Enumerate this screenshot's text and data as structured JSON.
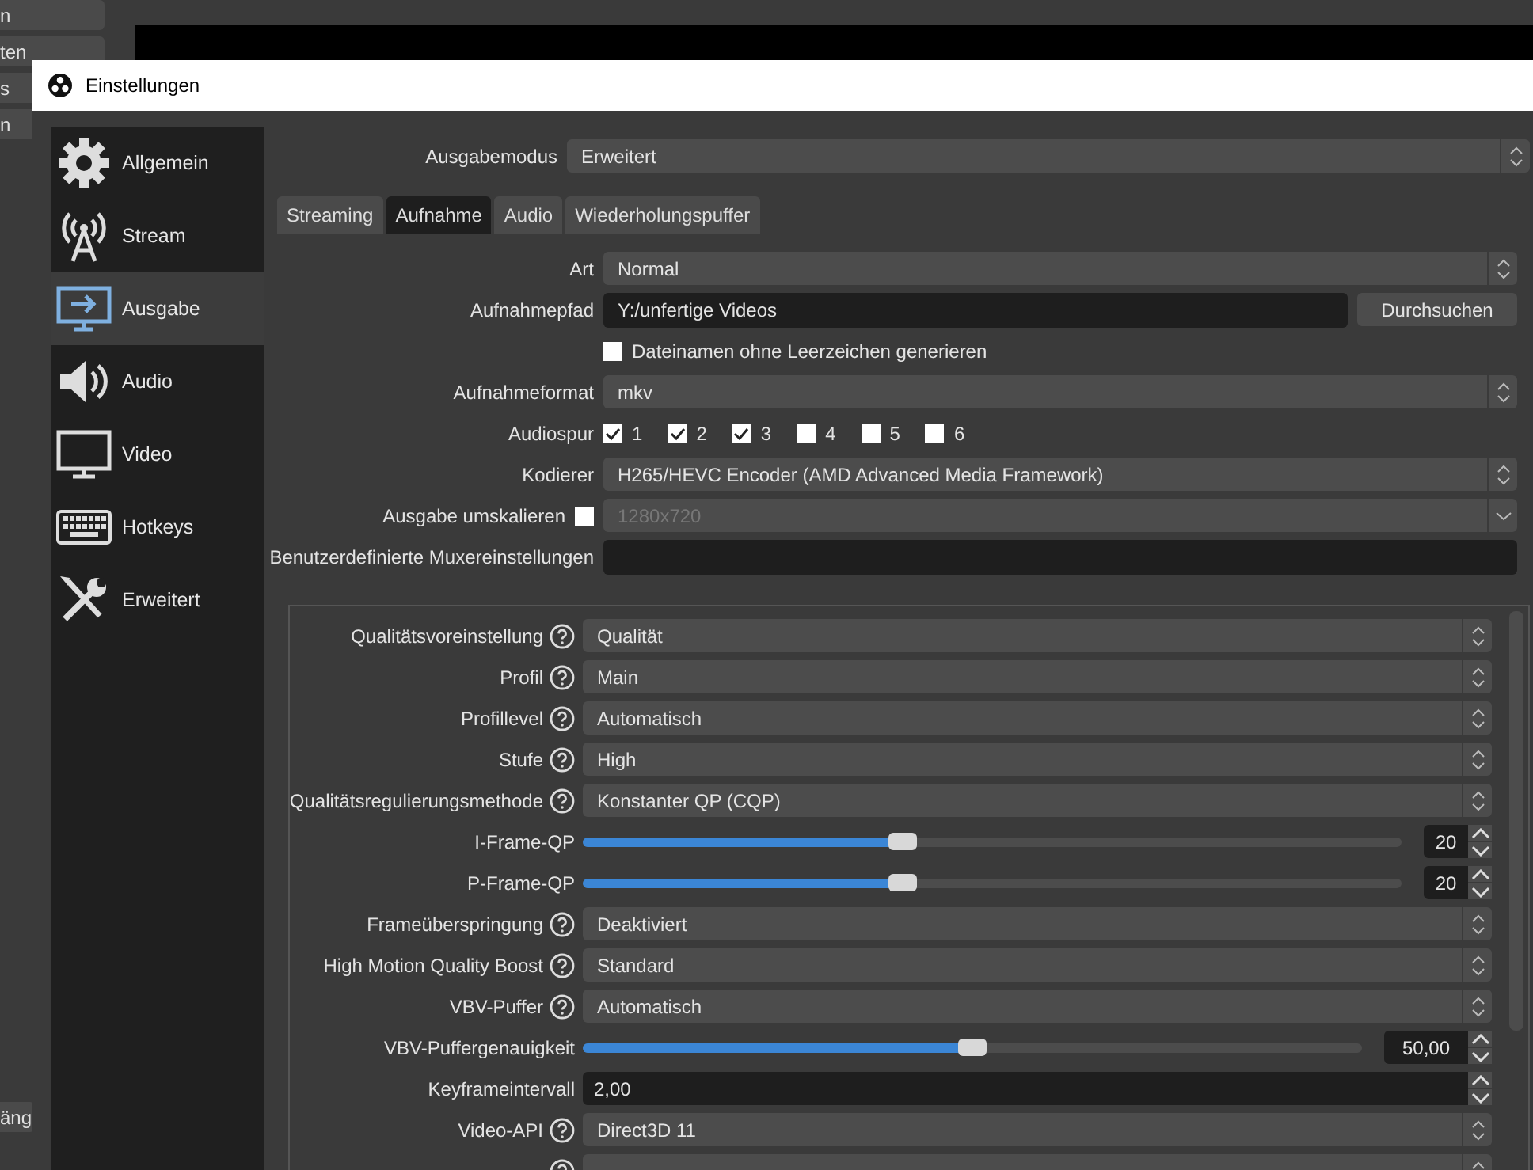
{
  "background_window": {
    "side_buttons": [
      "n",
      "ten",
      "s",
      "n"
    ],
    "bottom_button": "äng"
  },
  "window": {
    "title": "Einstellungen"
  },
  "sidebar": {
    "items": [
      {
        "label": "Allgemein",
        "kind": "gear",
        "selected": false
      },
      {
        "label": "Stream",
        "kind": "antenna",
        "selected": false
      },
      {
        "label": "Ausgabe",
        "kind": "output",
        "selected": true
      },
      {
        "label": "Audio",
        "kind": "speaker",
        "selected": false
      },
      {
        "label": "Video",
        "kind": "monitor",
        "selected": false
      },
      {
        "label": "Hotkeys",
        "kind": "keyboard",
        "selected": false
      },
      {
        "label": "Erweitert",
        "kind": "tools",
        "selected": false
      }
    ]
  },
  "output_mode": {
    "label": "Ausgabemodus",
    "value": "Erweitert"
  },
  "tabs": [
    {
      "label": "Streaming",
      "selected": false
    },
    {
      "label": "Aufnahme",
      "selected": true
    },
    {
      "label": "Audio",
      "selected": false
    },
    {
      "label": "Wiederholungspuffer",
      "selected": false
    }
  ],
  "recording": [
    {
      "kind": "combo",
      "label": "Art",
      "value": "Normal"
    },
    {
      "kind": "path",
      "label": "Aufnahmepfad",
      "value": "Y:/unfertige Videos",
      "button": "Durchsuchen"
    },
    {
      "kind": "checkbox",
      "text": "Dateinamen ohne Leerzeichen generieren",
      "checked": false
    },
    {
      "kind": "combo",
      "label": "Aufnahmeformat",
      "value": "mkv"
    },
    {
      "kind": "tracks",
      "label": "Audiospur",
      "tracks": [
        {
          "label": "1",
          "checked": true
        },
        {
          "label": "2",
          "checked": true
        },
        {
          "label": "3",
          "checked": true
        },
        {
          "label": "4",
          "checked": false
        },
        {
          "label": "5",
          "checked": false
        },
        {
          "label": "6",
          "checked": false
        }
      ]
    },
    {
      "kind": "combo",
      "label": "Kodierer",
      "value": "H265/HEVC Encoder (AMD Advanced Media Framework)"
    },
    {
      "kind": "scale",
      "label": "Ausgabe umskalieren",
      "checked": false,
      "value": "1280x720",
      "disabled": true
    },
    {
      "kind": "text",
      "label": "Benutzerdefinierte Muxereinstellungen"
    }
  ],
  "encoder_settings": [
    {
      "kind": "combo",
      "label": "Qualitätsvoreinstellung",
      "help": true,
      "value": "Qualität"
    },
    {
      "kind": "combo",
      "label": "Profil",
      "help": true,
      "value": "Main"
    },
    {
      "kind": "combo",
      "label": "Profillevel",
      "help": true,
      "value": "Automatisch"
    },
    {
      "kind": "combo",
      "label": "Stufe",
      "help": true,
      "value": "High"
    },
    {
      "kind": "combo",
      "label": "Qualitätsregulierungsmethode",
      "help": true,
      "value": "Konstanter QP (CQP)"
    },
    {
      "kind": "slider",
      "label": "I-Frame-QP",
      "help": false,
      "level": 0.39,
      "value": "20"
    },
    {
      "kind": "slider",
      "label": "P-Frame-QP",
      "help": false,
      "level": 0.39,
      "value": "20"
    },
    {
      "kind": "combo",
      "label": "Frameüberspringung",
      "help": true,
      "value": "Deaktiviert"
    },
    {
      "kind": "combo",
      "label": "High Motion Quality Boost",
      "help": true,
      "value": "Standard"
    },
    {
      "kind": "combo",
      "label": "VBV-Puffer",
      "help": true,
      "value": "Automatisch"
    },
    {
      "kind": "wideslider",
      "label": "VBV-Puffergenauigkeit",
      "help": false,
      "level": 0.5,
      "value": "50,00"
    },
    {
      "kind": "number",
      "label": "Keyframeintervall",
      "help": false,
      "value": "2,00"
    },
    {
      "kind": "combo",
      "label": "Video-API",
      "help": true,
      "value": "Direct3D 11"
    },
    {
      "kind": "combo",
      "help": true
    }
  ]
}
